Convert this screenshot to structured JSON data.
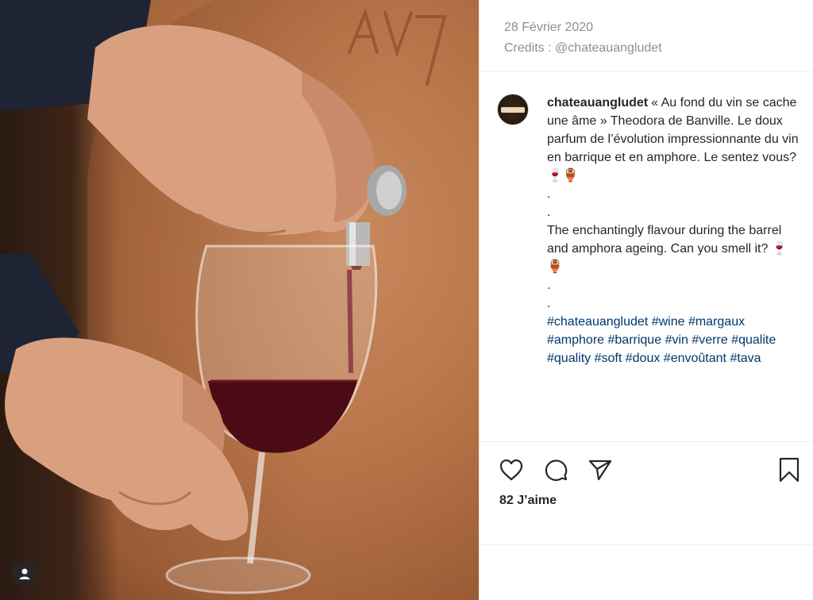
{
  "post": {
    "date": "28 Février 2020",
    "credits": "Credits : @chateauangludet",
    "username": "chateauangludet",
    "caption_lines": [
      "« Au fond du vin se cache une âme » Theodora de Banville. Le doux parfum de l’évolution impressionnante du vin en barrique et en amphore. Le sentez vous? 🍷🏺",
      ".",
      ".",
      "The enchantingly flavour during the barrel and amphora ageing. Can you smell it? 🍷🏺",
      ".",
      "."
    ],
    "hashtags": [
      "#chateauangludet",
      "#wine",
      "#margaux",
      "#amphore",
      "#barrique",
      "#vin",
      "#verre",
      "#qualite",
      "#quality",
      "#soft",
      "#doux",
      "#envoûtant",
      "#tava"
    ],
    "likes": "82 J’aime"
  },
  "icons": {
    "like": "heart-icon",
    "comment": "comment-icon",
    "share": "share-icon",
    "save": "bookmark-icon",
    "profile": "user-icon"
  },
  "colors": {
    "hashtag": "#00376b",
    "meta_text": "#8e8e8e",
    "text": "#262626"
  }
}
